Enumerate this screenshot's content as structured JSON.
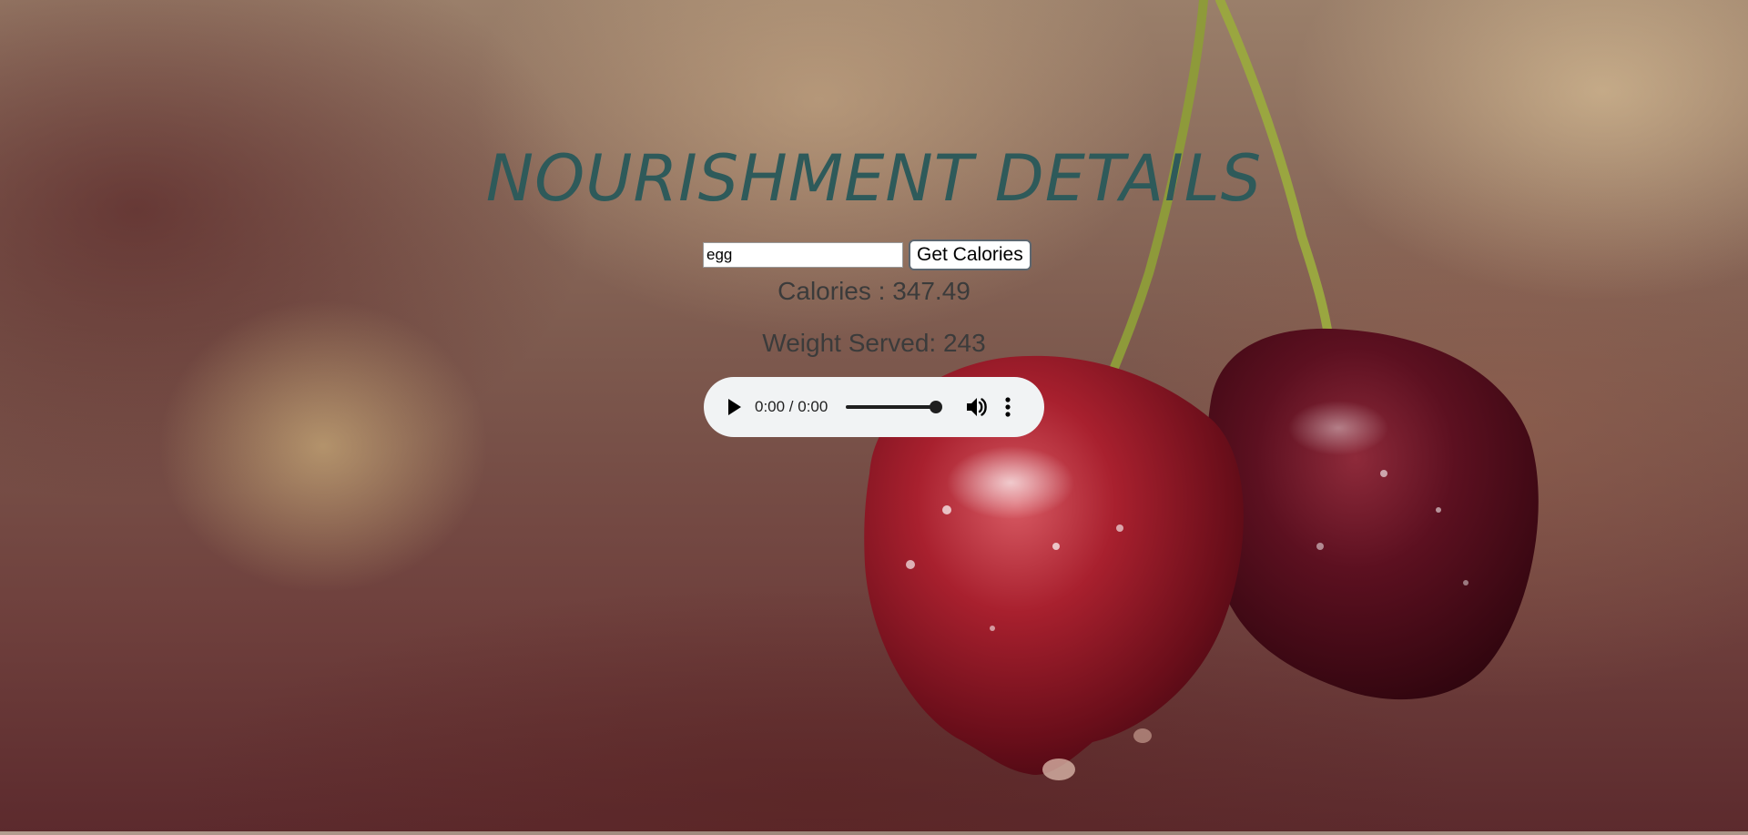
{
  "header": {
    "title": "NOURISHMENT DETAILS"
  },
  "search": {
    "value": "egg",
    "button_label": "Get Calories"
  },
  "results": {
    "calories_text": "Calories : 347.49",
    "weight_text": "Weight Served: 243"
  },
  "audio": {
    "time_display": "0:00 / 0:00",
    "play_icon": "play-icon",
    "volume_icon": "volume-icon",
    "more_icon": "more-vert-icon",
    "volume_level": 1.0
  },
  "background": {
    "subject": "cherries"
  },
  "colors": {
    "title": "#2e5a5a",
    "result_text": "#3b3b3b",
    "player_bg": "#f1f3f4"
  }
}
